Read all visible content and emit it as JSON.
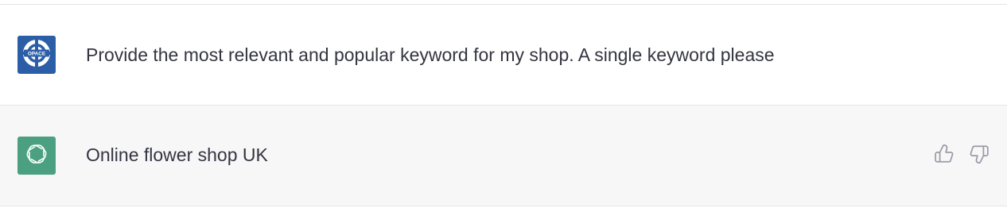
{
  "conversation": {
    "messages": [
      {
        "role": "user",
        "avatar_icon": "opace-logo-icon",
        "avatar_logo_text": "OPACE",
        "text": "Provide the most relevant and popular keyword for my shop. A single keyword please"
      },
      {
        "role": "assistant",
        "avatar_icon": "openai-logo-icon",
        "text": "Online flower shop UK",
        "actions": [
          {
            "icon": "thumbs-up-icon"
          },
          {
            "icon": "thumbs-down-icon"
          }
        ]
      }
    ]
  },
  "colors": {
    "user_avatar_bg": "#2c5ea8",
    "bot_avatar_bg": "#4aa081",
    "assistant_row_bg": "#f7f7f8",
    "text": "#343541",
    "icon_gray": "#9a9aa6"
  }
}
